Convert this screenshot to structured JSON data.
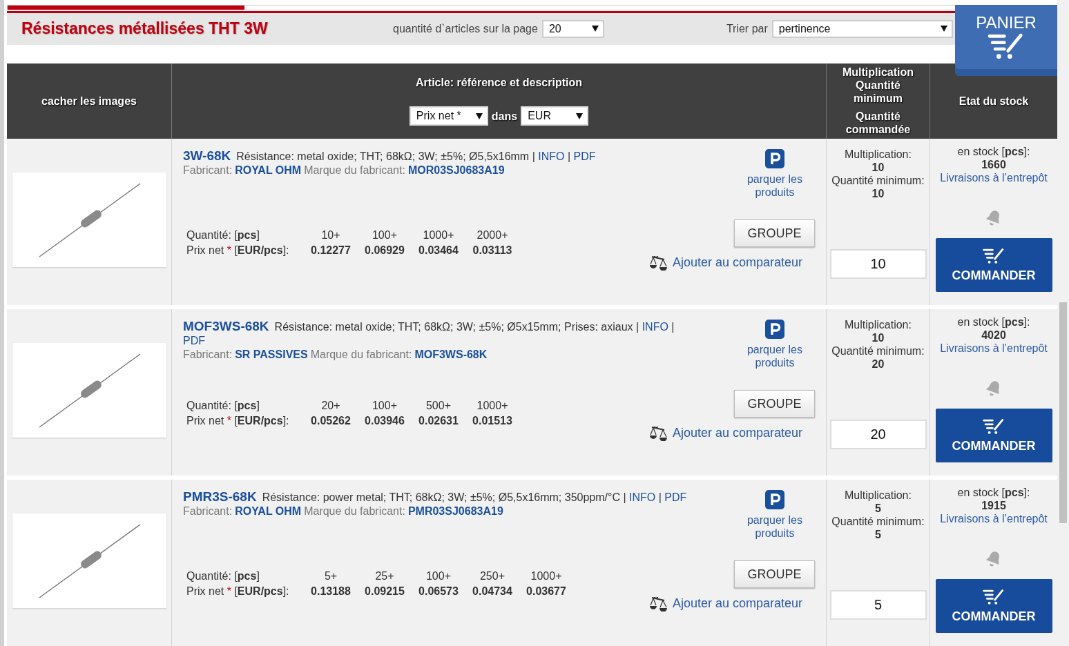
{
  "progress": {
    "level": 0.25
  },
  "page_title": "Résistances métallisées THT 3W",
  "per_page": {
    "label": "quantité d`articles sur la page",
    "value": "20"
  },
  "sort": {
    "label": "Trier par",
    "value": "pertinence"
  },
  "cart": {
    "label": "PANIER"
  },
  "header": {
    "hide_images": "cacher les images",
    "article_title": "Article: référence et description",
    "price_type": "Prix net *",
    "price_in": "dans",
    "currency": "EUR",
    "mult_lines": [
      "Multiplication",
      "Quantité",
      "minimum"
    ],
    "ordered_lines": [
      "Quantité",
      "commandée"
    ],
    "stock_title": "Etat du stock"
  },
  "products": [
    {
      "ref": "3W-68K",
      "description": "Résistance: metal oxide; THT; 68kΩ; 3W; ±5%; Ø5,5x16mm",
      "separator": "|",
      "info": "INFO",
      "pdf": "PDF",
      "maker_label": "Fabricant:",
      "maker": "ROYAL OHM",
      "brand_label": "Marque du fabricant:",
      "brand": "MOR03SJ0683A19",
      "park": "parquer les produits",
      "qty_label": "Quantité: [**pcs**]",
      "price_label": "Prix net",
      "price_star": "*",
      "price_unit": "[**EUR/pcs**]:",
      "tiers": [
        {
          "qty": "10+",
          "price": "0.12277"
        },
        {
          "qty": "100+",
          "price": "0.06929"
        },
        {
          "qty": "1000+",
          "price": "0.03464"
        },
        {
          "qty": "2000+",
          "price": "0.03113"
        }
      ],
      "group": "GROUPE",
      "compare": "Ajouter au comparateur",
      "mult_label": "Multiplication:",
      "mult": "10",
      "min_label": "Quantité minimum:",
      "min": "10",
      "quantity": "10",
      "stock_label": "en stock [**pcs**]:",
      "stock": "1660",
      "delivery": "Livraisons à l’entrepôt",
      "order": "COMMANDER"
    },
    {
      "ref": "MOF3WS-68K",
      "description": "Résistance: metal oxide; THT; 68kΩ; 3W; ±5%; Ø5x15mm; Prises: axiaux",
      "separator": "|",
      "info": "INFO",
      "pdf": "PDF",
      "maker_label": "Fabricant:",
      "maker": "SR PASSIVES",
      "brand_label": "Marque du fabricant:",
      "brand": "MOF3WS-68K",
      "park": "parquer les produits",
      "qty_label": "Quantité: [**pcs**]",
      "price_label": "Prix net",
      "price_star": "*",
      "price_unit": "[**EUR/pcs**]:",
      "tiers": [
        {
          "qty": "20+",
          "price": "0.05262"
        },
        {
          "qty": "100+",
          "price": "0.03946"
        },
        {
          "qty": "500+",
          "price": "0.02631"
        },
        {
          "qty": "1000+",
          "price": "0.01513"
        }
      ],
      "group": "GROUPE",
      "compare": "Ajouter au comparateur",
      "mult_label": "Multiplication:",
      "mult": "10",
      "min_label": "Quantité minimum:",
      "min": "20",
      "quantity": "20",
      "stock_label": "en stock [**pcs**]:",
      "stock": "4020",
      "delivery": "Livraisons à l’entrepôt",
      "order": "COMMANDER"
    },
    {
      "ref": "PMR3S-68K",
      "description": "Résistance: power metal; THT; 68kΩ; 3W; ±5%; Ø5,5x16mm; 350ppm/°C",
      "separator": "|",
      "info": "INFO",
      "pdf": "PDF",
      "maker_label": "Fabricant:",
      "maker": "ROYAL OHM",
      "brand_label": "Marque du fabricant:",
      "brand": "PMR03SJ0683A19",
      "park": "parquer les produits",
      "qty_label": "Quantité: [**pcs**]",
      "price_label": "Prix net",
      "price_star": "*",
      "price_unit": "[**EUR/pcs**]:",
      "tiers": [
        {
          "qty": "5+",
          "price": "0.13188"
        },
        {
          "qty": "25+",
          "price": "0.09215"
        },
        {
          "qty": "100+",
          "price": "0.06573"
        },
        {
          "qty": "250+",
          "price": "0.04734"
        },
        {
          "qty": "1000+",
          "price": "0.03677"
        }
      ],
      "group": "GROUPE",
      "compare": "Ajouter au comparateur",
      "mult_label": "Multiplication:",
      "mult": "5",
      "min_label": "Quantité minimum:",
      "min": "5",
      "quantity": "5",
      "stock_label": "en stock [**pcs**]:",
      "stock": "1915",
      "delivery": "Livraisons à l’entrepôt",
      "order": "COMMANDER"
    }
  ]
}
